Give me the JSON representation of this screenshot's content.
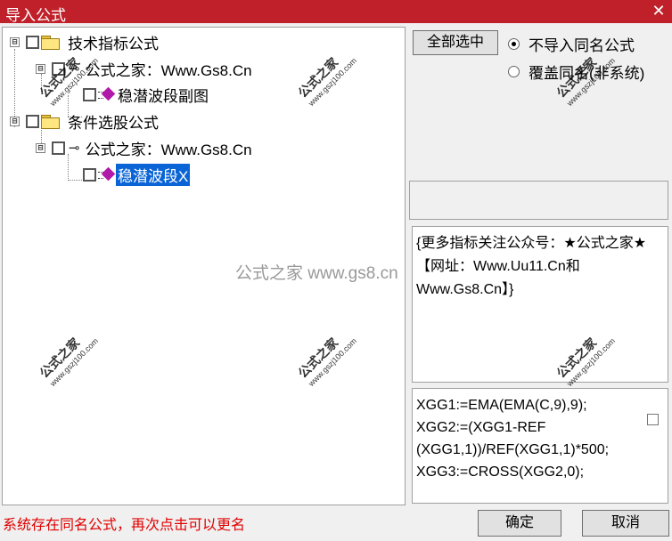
{
  "window": {
    "title": "导入公式",
    "close_glyph": "✕"
  },
  "tree": {
    "group1": {
      "expander": "⊟",
      "label": "技术指标公式"
    },
    "group1_child": {
      "expander": "⊟",
      "key_glyph": "⊸",
      "label": "公式之家：Www.Gs8.Cn"
    },
    "group1_leaf": {
      "label": "稳潜波段副图"
    },
    "group2": {
      "expander": "⊟",
      "label": "条件选股公式"
    },
    "group2_child": {
      "expander": "⊟",
      "key_glyph": "⊸",
      "label": "公式之家：Www.Gs8.Cn"
    },
    "group2_leaf": {
      "label": "稳潜波段X",
      "selected": true
    }
  },
  "buttons": {
    "select_all": "全部选中",
    "ok": "确定",
    "cancel": "取消"
  },
  "options": {
    "no_import_same": {
      "label": "不导入同名公式",
      "checked": true
    },
    "overwrite_same": {
      "label": "覆盖同名(非系统)",
      "checked": false
    }
  },
  "description": "{更多指标关注公众号：★公式之家★ 【网址：Www.Uu11.Cn和Www.Gs8.Cn】}",
  "code_lines": [
    "XGG1:=EMA(EMA(C,9),9);",
    "XGG2:=(XGG1-REF",
    "(XGG1,1))/REF(XGG1,1)*500;",
    "XGG3:=CROSS(XGG2,0);"
  ],
  "status": "系统存在同名公式，再次点击可以更名",
  "watermark": {
    "text": "公式之家",
    "url": "www.gszj100.com",
    "center": "公式之家 www.gs8.cn"
  },
  "colors": {
    "title_bar": "#c0202a",
    "selection": "#0a64d6",
    "status_text": "#e00000",
    "gem": "#b01aa8"
  }
}
